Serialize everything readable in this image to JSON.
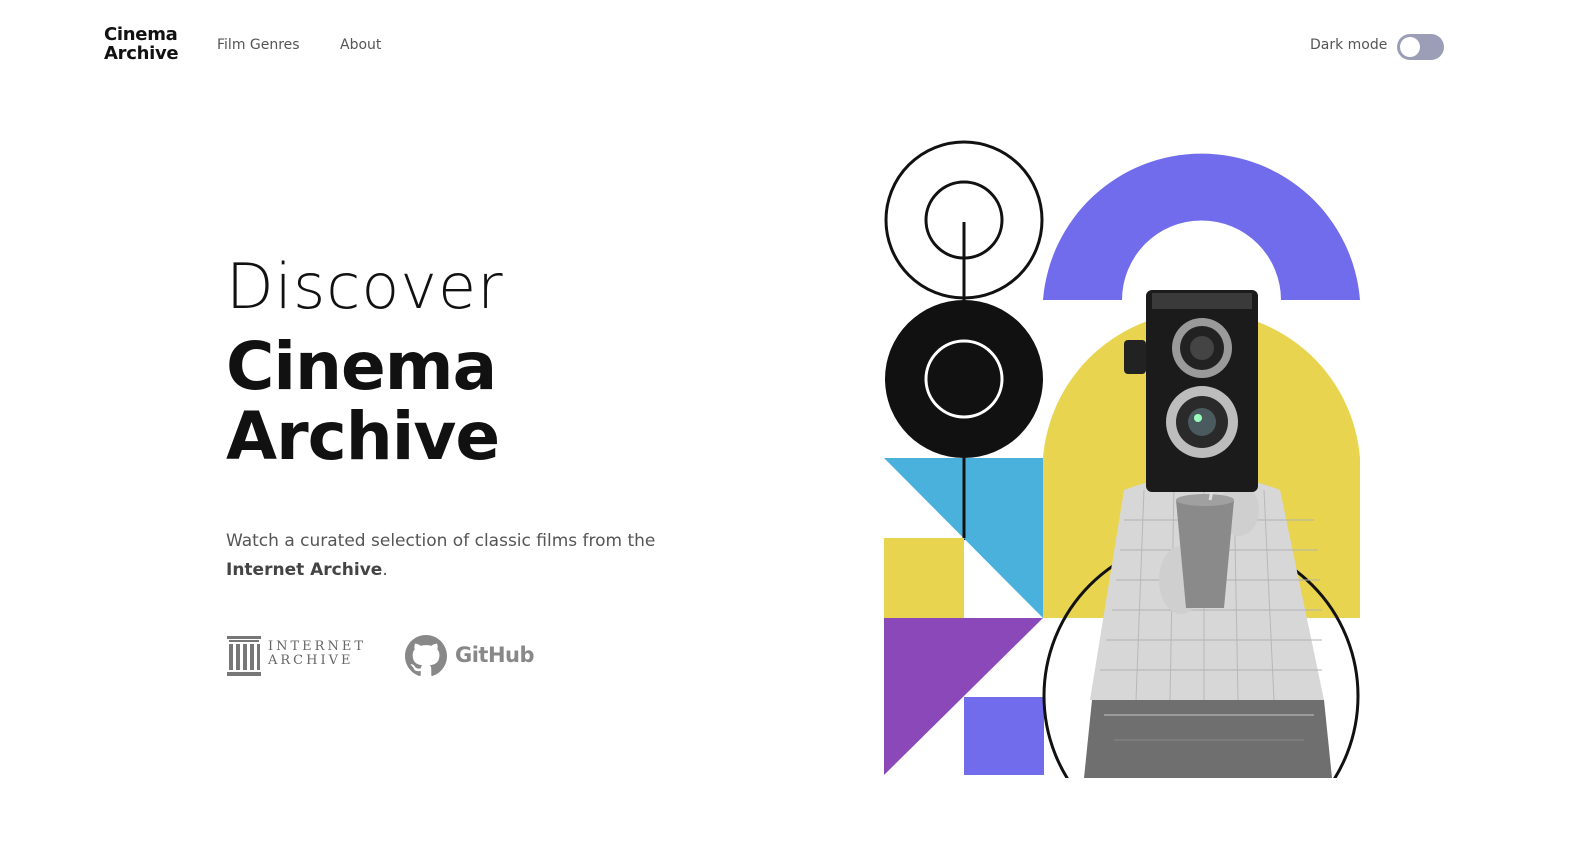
{
  "header": {
    "logo_line1": "Cinema",
    "logo_line2": "Archive",
    "nav": [
      {
        "label": "Film Genres"
      },
      {
        "label": "About"
      }
    ],
    "dark_mode_label": "Dark mode",
    "dark_mode_on": false
  },
  "hero": {
    "discover": "Discover",
    "title_line1": "Cinema",
    "title_line2": "Archive",
    "desc_prefix": "Watch a curated selection of classic films from the ",
    "desc_link": "Internet Archive",
    "desc_suffix": "."
  },
  "links": {
    "internet_archive_line1": "INTERNET",
    "internet_archive_line2": "ARCHIVE",
    "github": "GitHub"
  },
  "colors": {
    "purple": "#706cec",
    "yellow": "#e8d44e",
    "blue": "#4ab0dc",
    "violet": "#8b48b8",
    "black": "#111111"
  }
}
